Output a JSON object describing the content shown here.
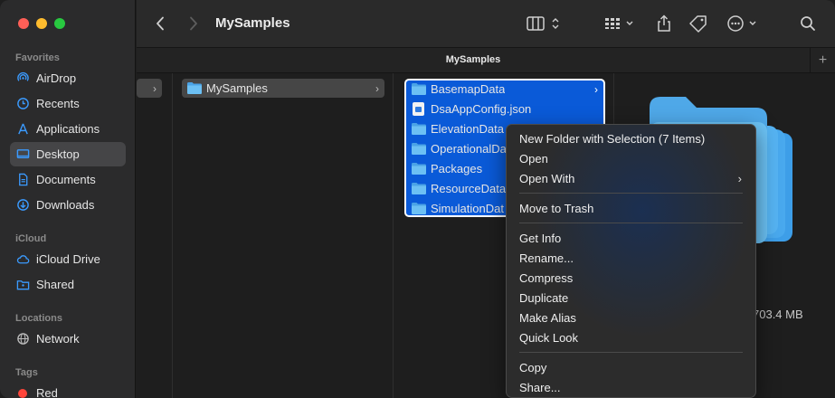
{
  "sidebar": {
    "sections": {
      "favorites": "Favorites",
      "icloud": "iCloud",
      "locations": "Locations",
      "tags": "Tags"
    },
    "favorites": [
      {
        "label": "AirDrop",
        "icon": "airdrop-icon"
      },
      {
        "label": "Recents",
        "icon": "clock-icon"
      },
      {
        "label": "Applications",
        "icon": "applications-icon"
      },
      {
        "label": "Desktop",
        "icon": "desktop-icon",
        "active": true
      },
      {
        "label": "Documents",
        "icon": "document-icon"
      },
      {
        "label": "Downloads",
        "icon": "download-icon"
      }
    ],
    "icloud": [
      {
        "label": "iCloud Drive",
        "icon": "cloud-icon"
      },
      {
        "label": "Shared",
        "icon": "shared-folder-icon"
      }
    ],
    "locations": [
      {
        "label": "Network",
        "icon": "network-icon"
      }
    ],
    "tags": [
      {
        "label": "Red",
        "color": "#ff453a"
      }
    ]
  },
  "toolbar": {
    "title": "MySamples"
  },
  "tabbar": {
    "title": "MySamples",
    "add": "+"
  },
  "columns": {
    "col2": [
      {
        "label": "MySamples",
        "type": "folder"
      }
    ],
    "col3": [
      {
        "label": "BasemapData",
        "type": "folder"
      },
      {
        "label": "DsaAppConfig.json",
        "type": "file"
      },
      {
        "label": "ElevationData",
        "type": "folder"
      },
      {
        "label": "OperationalDa",
        "type": "folder"
      },
      {
        "label": "Packages",
        "type": "folder"
      },
      {
        "label": "ResourceData",
        "type": "folder"
      },
      {
        "label": "SimulationDat",
        "type": "folder"
      }
    ]
  },
  "preview": {
    "size": "703.4 MB"
  },
  "context_menu": {
    "groups": [
      [
        "New Folder with Selection (7 Items)",
        "Open",
        "Open With"
      ],
      [
        "Move to Trash"
      ],
      [
        "Get Info",
        "Rename...",
        "Compress",
        "Duplicate",
        "Make Alias",
        "Quick Look"
      ],
      [
        "Copy",
        "Share..."
      ]
    ]
  },
  "colors": {
    "selection": "#0a5ad8",
    "folder": "#5ab0ea",
    "tag_red": "#ff453a"
  }
}
